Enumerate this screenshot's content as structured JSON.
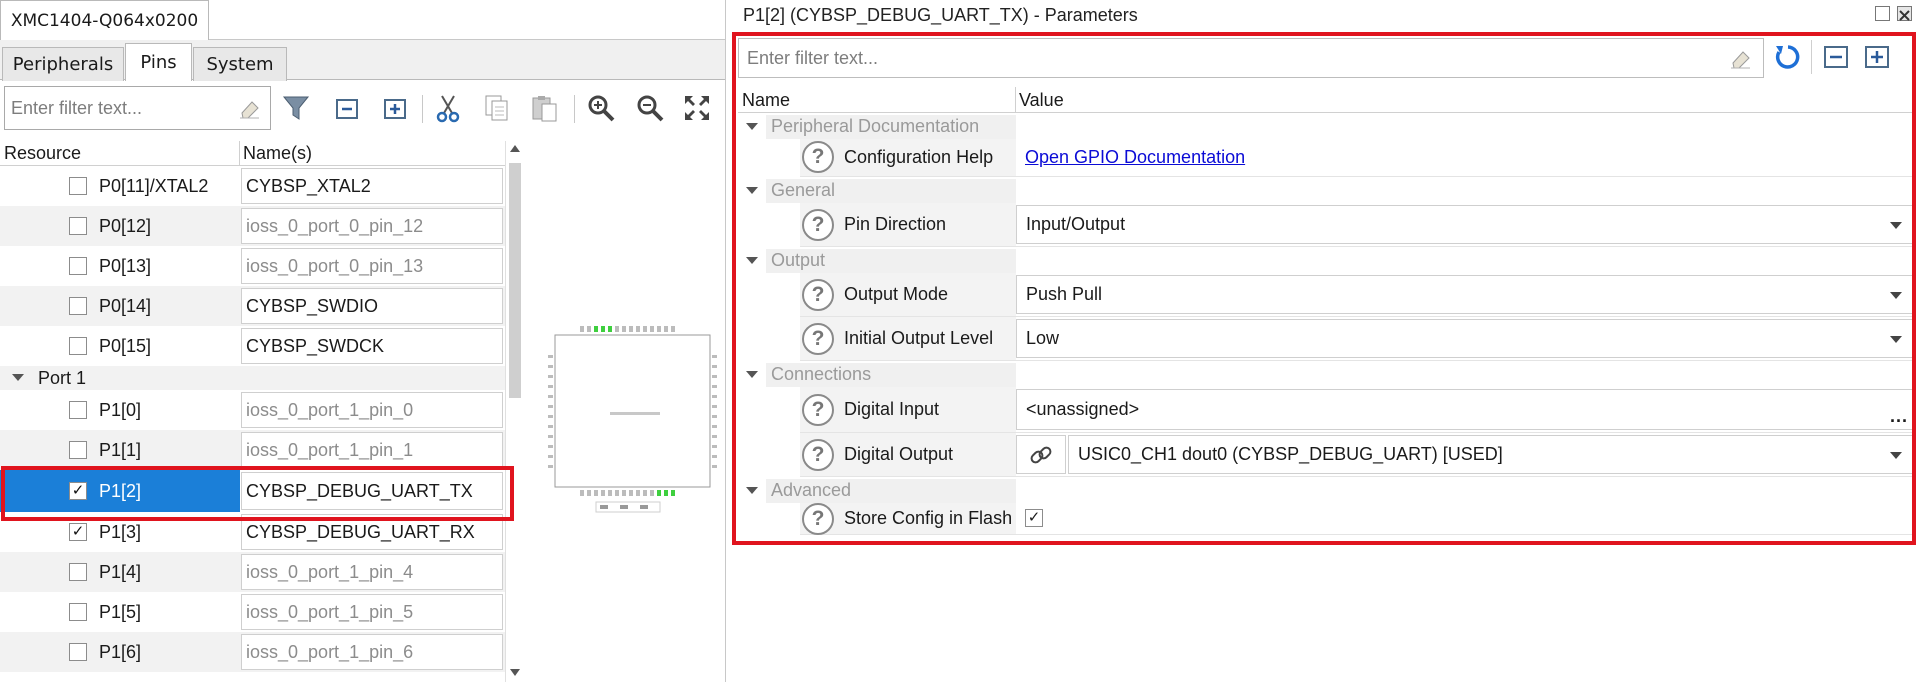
{
  "left": {
    "device_tab": "XMC1404-Q064x0200",
    "subtabs": [
      "Peripherals",
      "Pins",
      "System"
    ],
    "filter_placeholder": "Enter filter text...",
    "columns": {
      "resource": "Resource",
      "names": "Name(s)"
    },
    "rows": [
      {
        "resource": "P0[11]/XTAL2",
        "name": "CYBSP_XTAL2",
        "checked": false,
        "named": true
      },
      {
        "resource": "P0[12]",
        "name": "ioss_0_port_0_pin_12",
        "checked": false,
        "named": false
      },
      {
        "resource": "P0[13]",
        "name": "ioss_0_port_0_pin_13",
        "checked": false,
        "named": false
      },
      {
        "resource": "P0[14]",
        "name": "CYBSP_SWDIO",
        "checked": false,
        "named": true
      },
      {
        "resource": "P0[15]",
        "name": "CYBSP_SWDCK",
        "checked": false,
        "named": true
      }
    ],
    "group": "Port 1",
    "rows2": [
      {
        "resource": "P1[0]",
        "name": "ioss_0_port_1_pin_0",
        "checked": false,
        "named": false
      },
      {
        "resource": "P1[1]",
        "name": "ioss_0_port_1_pin_1",
        "checked": false,
        "named": false
      },
      {
        "resource": "P1[2]",
        "name": "CYBSP_DEBUG_UART_TX",
        "checked": true,
        "named": true,
        "selected": true
      },
      {
        "resource": "P1[3]",
        "name": "CYBSP_DEBUG_UART_RX",
        "checked": true,
        "named": true
      },
      {
        "resource": "P1[4]",
        "name": "ioss_0_port_1_pin_4",
        "checked": false,
        "named": false
      },
      {
        "resource": "P1[5]",
        "name": "ioss_0_port_1_pin_5",
        "checked": false,
        "named": false
      },
      {
        "resource": "P1[6]",
        "name": "ioss_0_port_1_pin_6",
        "checked": false,
        "named": false
      }
    ],
    "toolbar_icons": [
      "filter-icon",
      "collapse-all-icon",
      "expand-all-icon",
      "cut-icon",
      "copy-icon",
      "paste-icon",
      "zoom-in-icon",
      "zoom-out-icon",
      "fit-icon"
    ]
  },
  "right": {
    "title": "P1[2] (CYBSP_DEBUG_UART_TX) - Parameters",
    "filter_placeholder": "Enter filter text...",
    "columns": {
      "name": "Name",
      "value": "Value"
    },
    "sections": {
      "peripheral_doc": "Peripheral Documentation",
      "general": "General",
      "output": "Output",
      "connections": "Connections",
      "advanced": "Advanced"
    },
    "params": {
      "config_help": {
        "label": "Configuration Help",
        "value": "Open GPIO Documentation"
      },
      "pin_direction": {
        "label": "Pin Direction",
        "value": "Input/Output"
      },
      "output_mode": {
        "label": "Output Mode",
        "value": "Push Pull"
      },
      "initial_output_level": {
        "label": "Initial Output Level",
        "value": "Low"
      },
      "digital_input": {
        "label": "Digital Input",
        "value": "<unassigned>",
        "more": "..."
      },
      "digital_output": {
        "label": "Digital Output",
        "value": "USIC0_CH1 dout0 (CYBSP_DEBUG_UART) [USED]"
      },
      "store_config": {
        "label": "Store Config in Flash",
        "checked": true
      }
    },
    "help_glyph": "?",
    "check_glyph": "✓"
  },
  "colors": {
    "selection": "#1b7fd8",
    "highlight_border": "#e0141e",
    "link": "#0b0bd6"
  }
}
